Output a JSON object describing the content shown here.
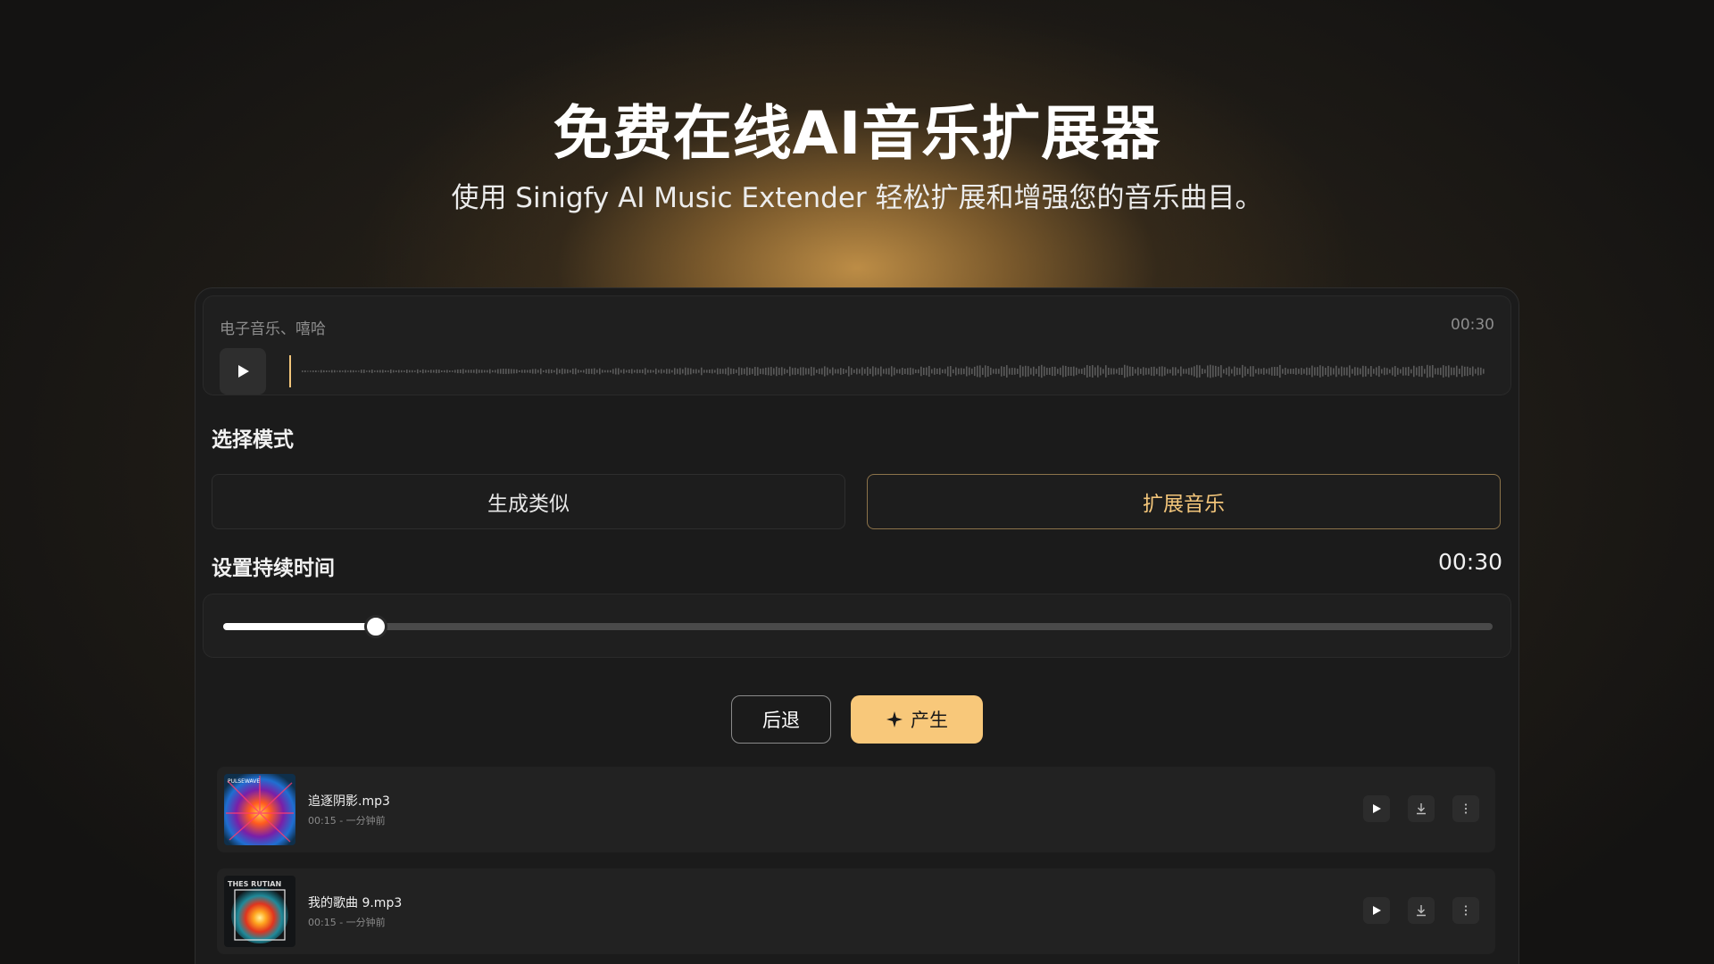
{
  "hero": {
    "title": "免费在线AI音乐扩展器",
    "subtitle": "使用 Sinigfy AI Music Extender 轻松扩展和增强您的音乐曲目。"
  },
  "audio": {
    "tags": "电子音乐、嘻哈",
    "duration": "00:30",
    "play_icon": "play-icon"
  },
  "mode": {
    "label": "选择模式",
    "options": [
      {
        "label": "生成类似",
        "selected": false
      },
      {
        "label": "扩展音乐",
        "selected": true
      }
    ]
  },
  "duration": {
    "label": "设置持续时间",
    "value": "00:30",
    "slider_fraction": 0.12
  },
  "actions": {
    "back_label": "后退",
    "generate_label": "产生",
    "generate_icon": "sparkle-icon"
  },
  "tracks": [
    {
      "name": "追逐阴影.mp3",
      "meta": "00:15 - 一分钟前",
      "cover_text": "PULSEWAVE"
    },
    {
      "name": "我的歌曲 9.mp3",
      "meta": "00:15 - 一分钟前",
      "cover_text": "THES RUTIAN"
    }
  ],
  "colors": {
    "accent": "#f8c87a",
    "accent_text": "#f2c57a",
    "panel": "#1b1b1b"
  }
}
